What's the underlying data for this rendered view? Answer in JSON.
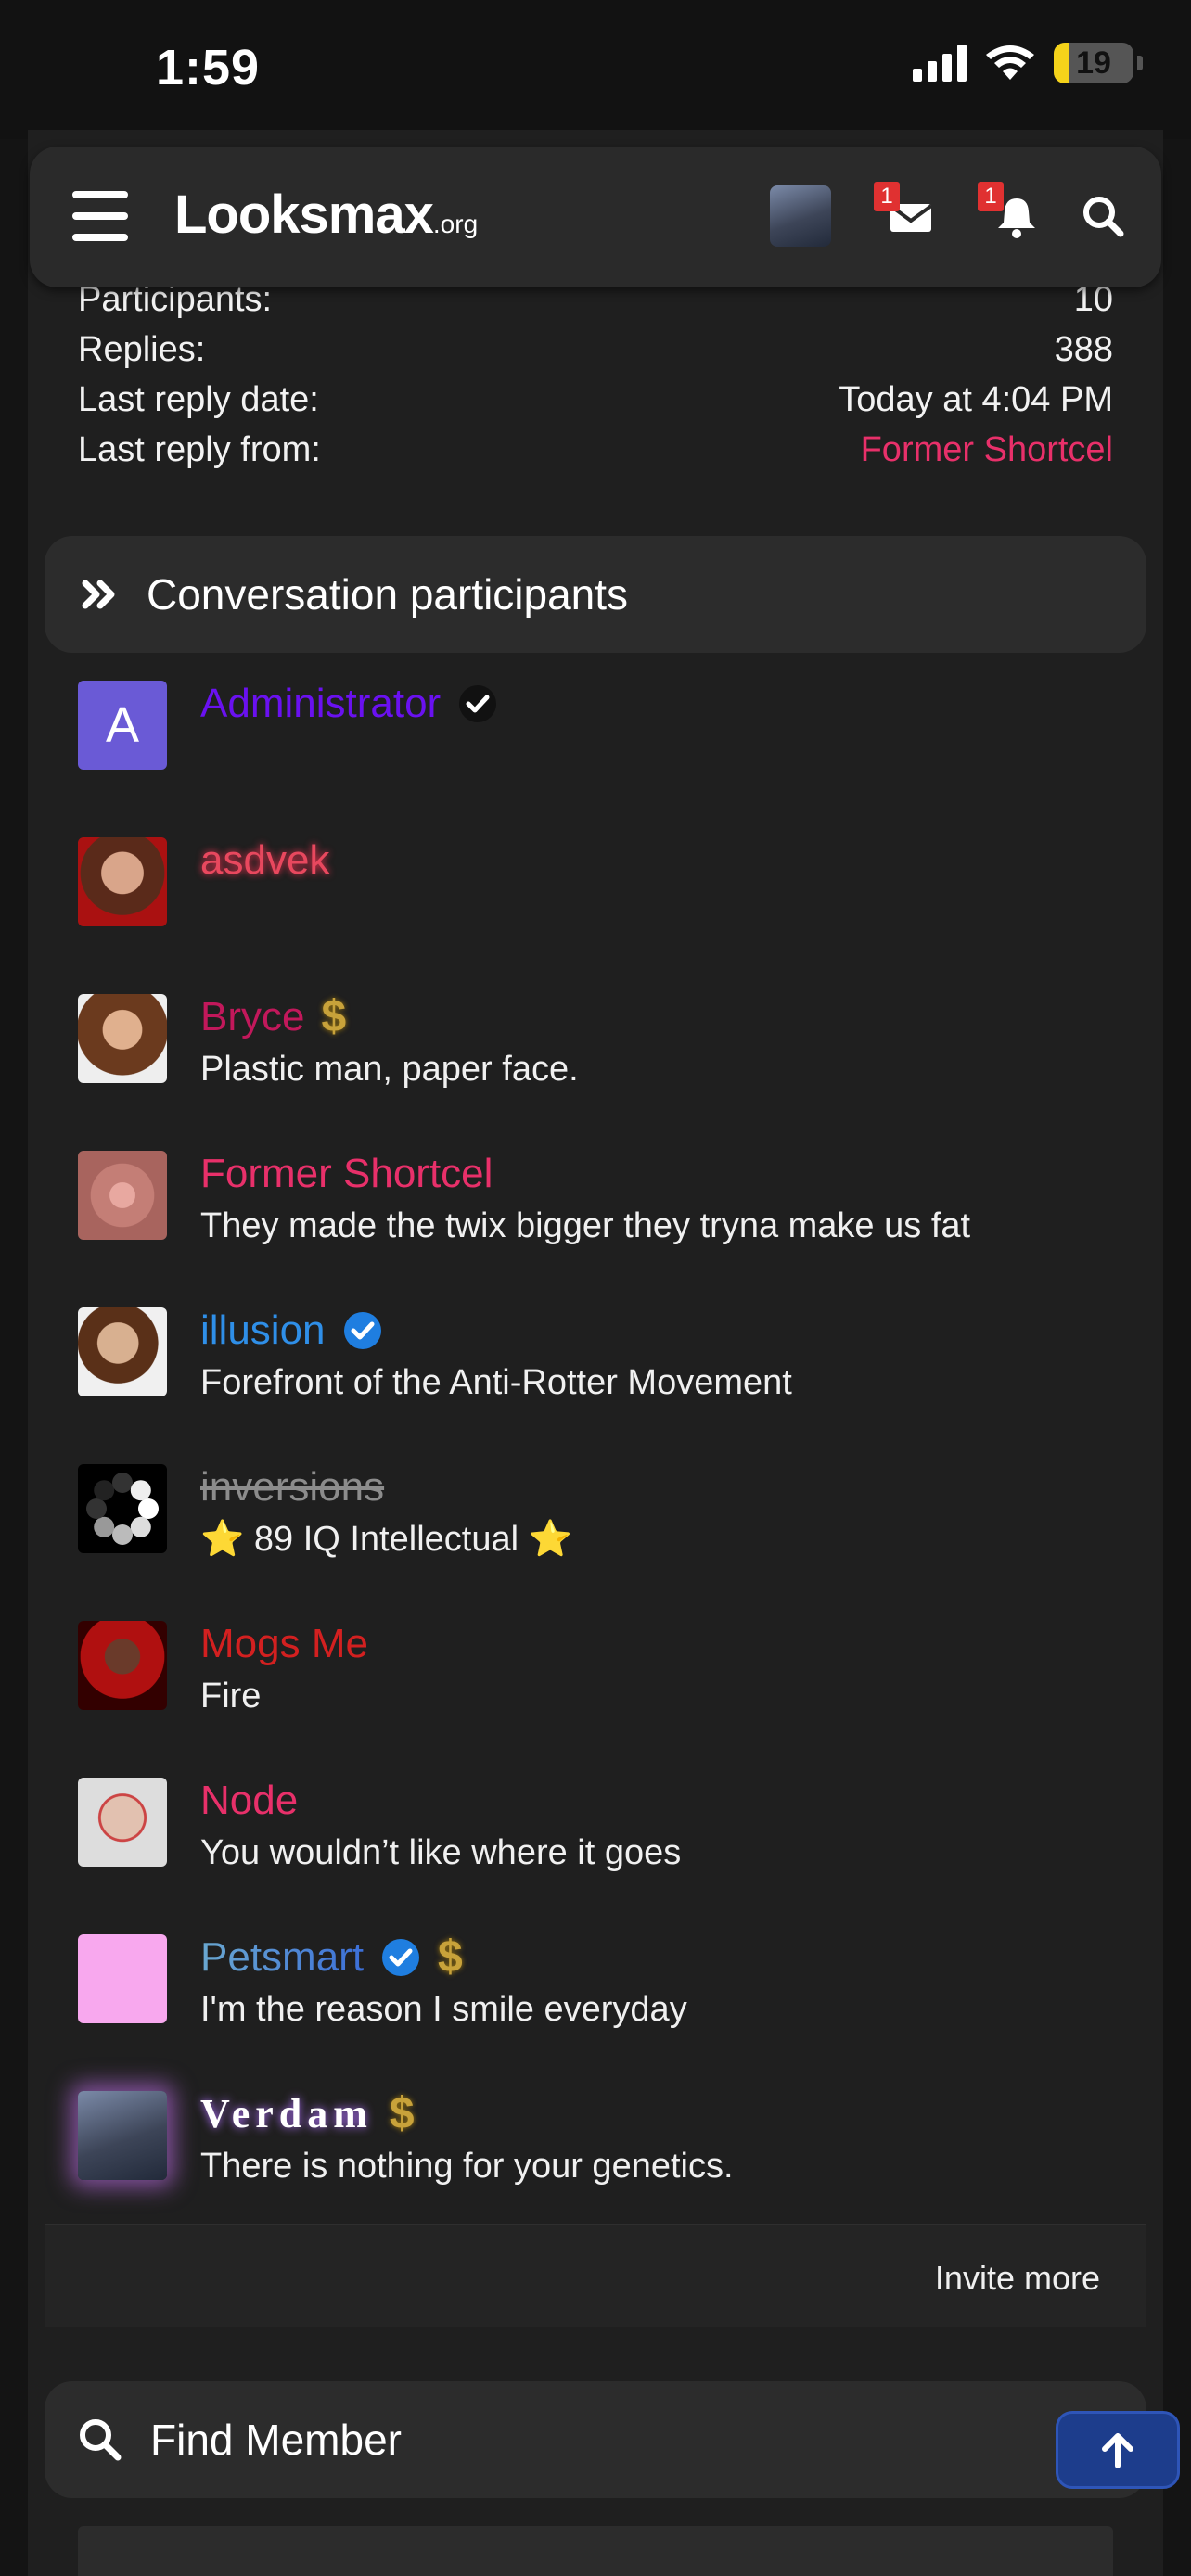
{
  "status_bar": {
    "time": "1:59",
    "battery": "19",
    "battery_level": 0.19
  },
  "header": {
    "logo_main": "Lᴏᴏksmax",
    "logo_suffix": ".org",
    "messages_badge": "1",
    "alerts_badge": "1"
  },
  "stats": [
    {
      "label": "Participants:",
      "value": "10",
      "link": false
    },
    {
      "label": "Replies:",
      "value": "388",
      "link": false
    },
    {
      "label": "Last reply date:",
      "value": "Today at 4:04 PM",
      "link": false
    },
    {
      "label": "Last reply from:",
      "value": "Former Shortcel",
      "link": true
    }
  ],
  "section": {
    "title": "Conversation participants"
  },
  "participants": [
    {
      "name": "Administrator",
      "title": "",
      "color": "#6a11f0",
      "badge": "black-check",
      "dollar": false
    },
    {
      "name": "asdvek",
      "title": "",
      "color": "#e8485e",
      "badge": "",
      "dollar": false
    },
    {
      "name": "Bryce",
      "title": "Plastic man, paper face.",
      "color": "#c2185b",
      "badge": "",
      "dollar": true
    },
    {
      "name": "Former Shortcel",
      "title": "They made the twix bigger they tryna make us fat",
      "color": "#e8306a",
      "badge": "",
      "dollar": false
    },
    {
      "name": "illusion",
      "title": "Forefront of the Anti-Rotter Movement",
      "color": "#2f8fe8",
      "badge": "blue-check",
      "dollar": false
    },
    {
      "name": "inversions",
      "title": "⭐ 89 IQ Intellectual ⭐",
      "color": "#8c8c8c",
      "badge": "",
      "dollar": false
    },
    {
      "name": "Mogs Me",
      "title": "Fire",
      "color": "#d32020",
      "badge": "",
      "dollar": false
    },
    {
      "name": "Node",
      "title": "You wouldn’t like where it goes",
      "color": "#e8306a",
      "badge": "",
      "dollar": false
    },
    {
      "name": "Petsmart",
      "title": "I'm the reason I smile everyday",
      "color": "#4a8dd6",
      "badge": "blue-check",
      "dollar": true
    },
    {
      "name": "Verdam",
      "title": "There is nothing for your genetics.",
      "color": "#ffffff",
      "badge": "",
      "dollar": true
    }
  ],
  "invite": {
    "label": "Invite more"
  },
  "find": {
    "title": "Find Member"
  },
  "colors": {
    "accent": "#e8306a",
    "panel": "#2c2c2c",
    "bg": "#1f1f1f"
  }
}
